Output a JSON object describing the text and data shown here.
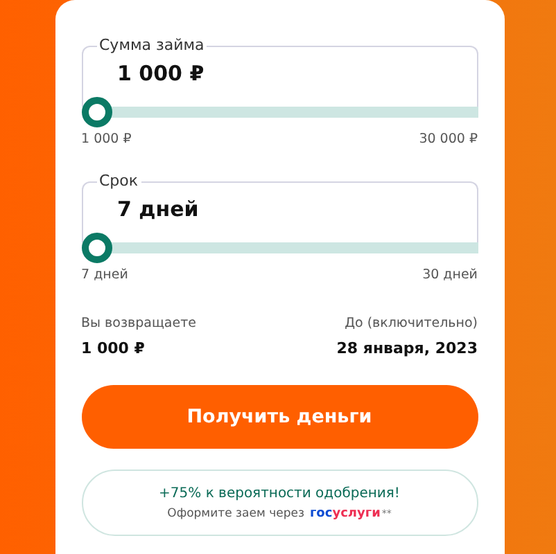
{
  "sliders": [
    {
      "label": "Сумма займа",
      "value": "1 000 ₽",
      "level": 0,
      "min": "1 000 ₽",
      "max": "30 000 ₽"
    },
    {
      "label": "Срок",
      "value": "7 дней",
      "level": 0,
      "min": "7 дней",
      "max": "30 дней"
    }
  ],
  "summary": {
    "return_label": "Вы возвращаете",
    "return_value": "1 000 ₽",
    "due_label": "До (включительно)",
    "due_value": "28 января, 2023"
  },
  "submit_button": "Получить деньги",
  "promo": {
    "headline": "+75% к вероятности одобрения!",
    "text": "Оформите заем через",
    "logo": {
      "part_1": "гос",
      "part_2": "услуги"
    },
    "note": "**"
  }
}
